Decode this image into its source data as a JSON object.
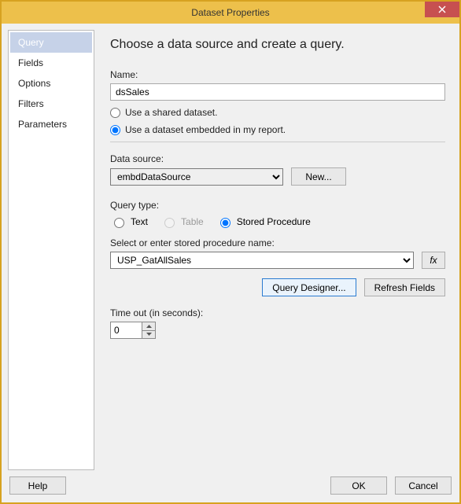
{
  "window": {
    "title": "Dataset Properties"
  },
  "sidebar": {
    "items": [
      {
        "label": "Query",
        "selected": true
      },
      {
        "label": "Fields",
        "selected": false
      },
      {
        "label": "Options",
        "selected": false
      },
      {
        "label": "Filters",
        "selected": false
      },
      {
        "label": "Parameters",
        "selected": false
      }
    ]
  },
  "content": {
    "heading": "Choose a data source and create a query.",
    "name_label": "Name:",
    "name_value": "dsSales",
    "dataset_mode": {
      "shared_label": "Use a shared dataset.",
      "embedded_label": "Use a dataset embedded in my report.",
      "selected": "embedded"
    },
    "datasource": {
      "label": "Data source:",
      "value": "embdDataSource",
      "new_btn": "New..."
    },
    "querytype": {
      "label": "Query type:",
      "options": [
        {
          "label": "Text",
          "value": "text",
          "enabled": true
        },
        {
          "label": "Table",
          "value": "table",
          "enabled": false
        },
        {
          "label": "Stored Procedure",
          "value": "sp",
          "enabled": true
        }
      ],
      "selected": "sp"
    },
    "stored_proc": {
      "label": "Select or enter stored procedure name:",
      "value": "USP_GatAllSales",
      "fx_label": "fx"
    },
    "actions": {
      "query_designer": "Query Designer...",
      "refresh_fields": "Refresh Fields"
    },
    "timeout": {
      "label": "Time out (in seconds):",
      "value": "0"
    }
  },
  "footer": {
    "help": "Help",
    "ok": "OK",
    "cancel": "Cancel"
  }
}
